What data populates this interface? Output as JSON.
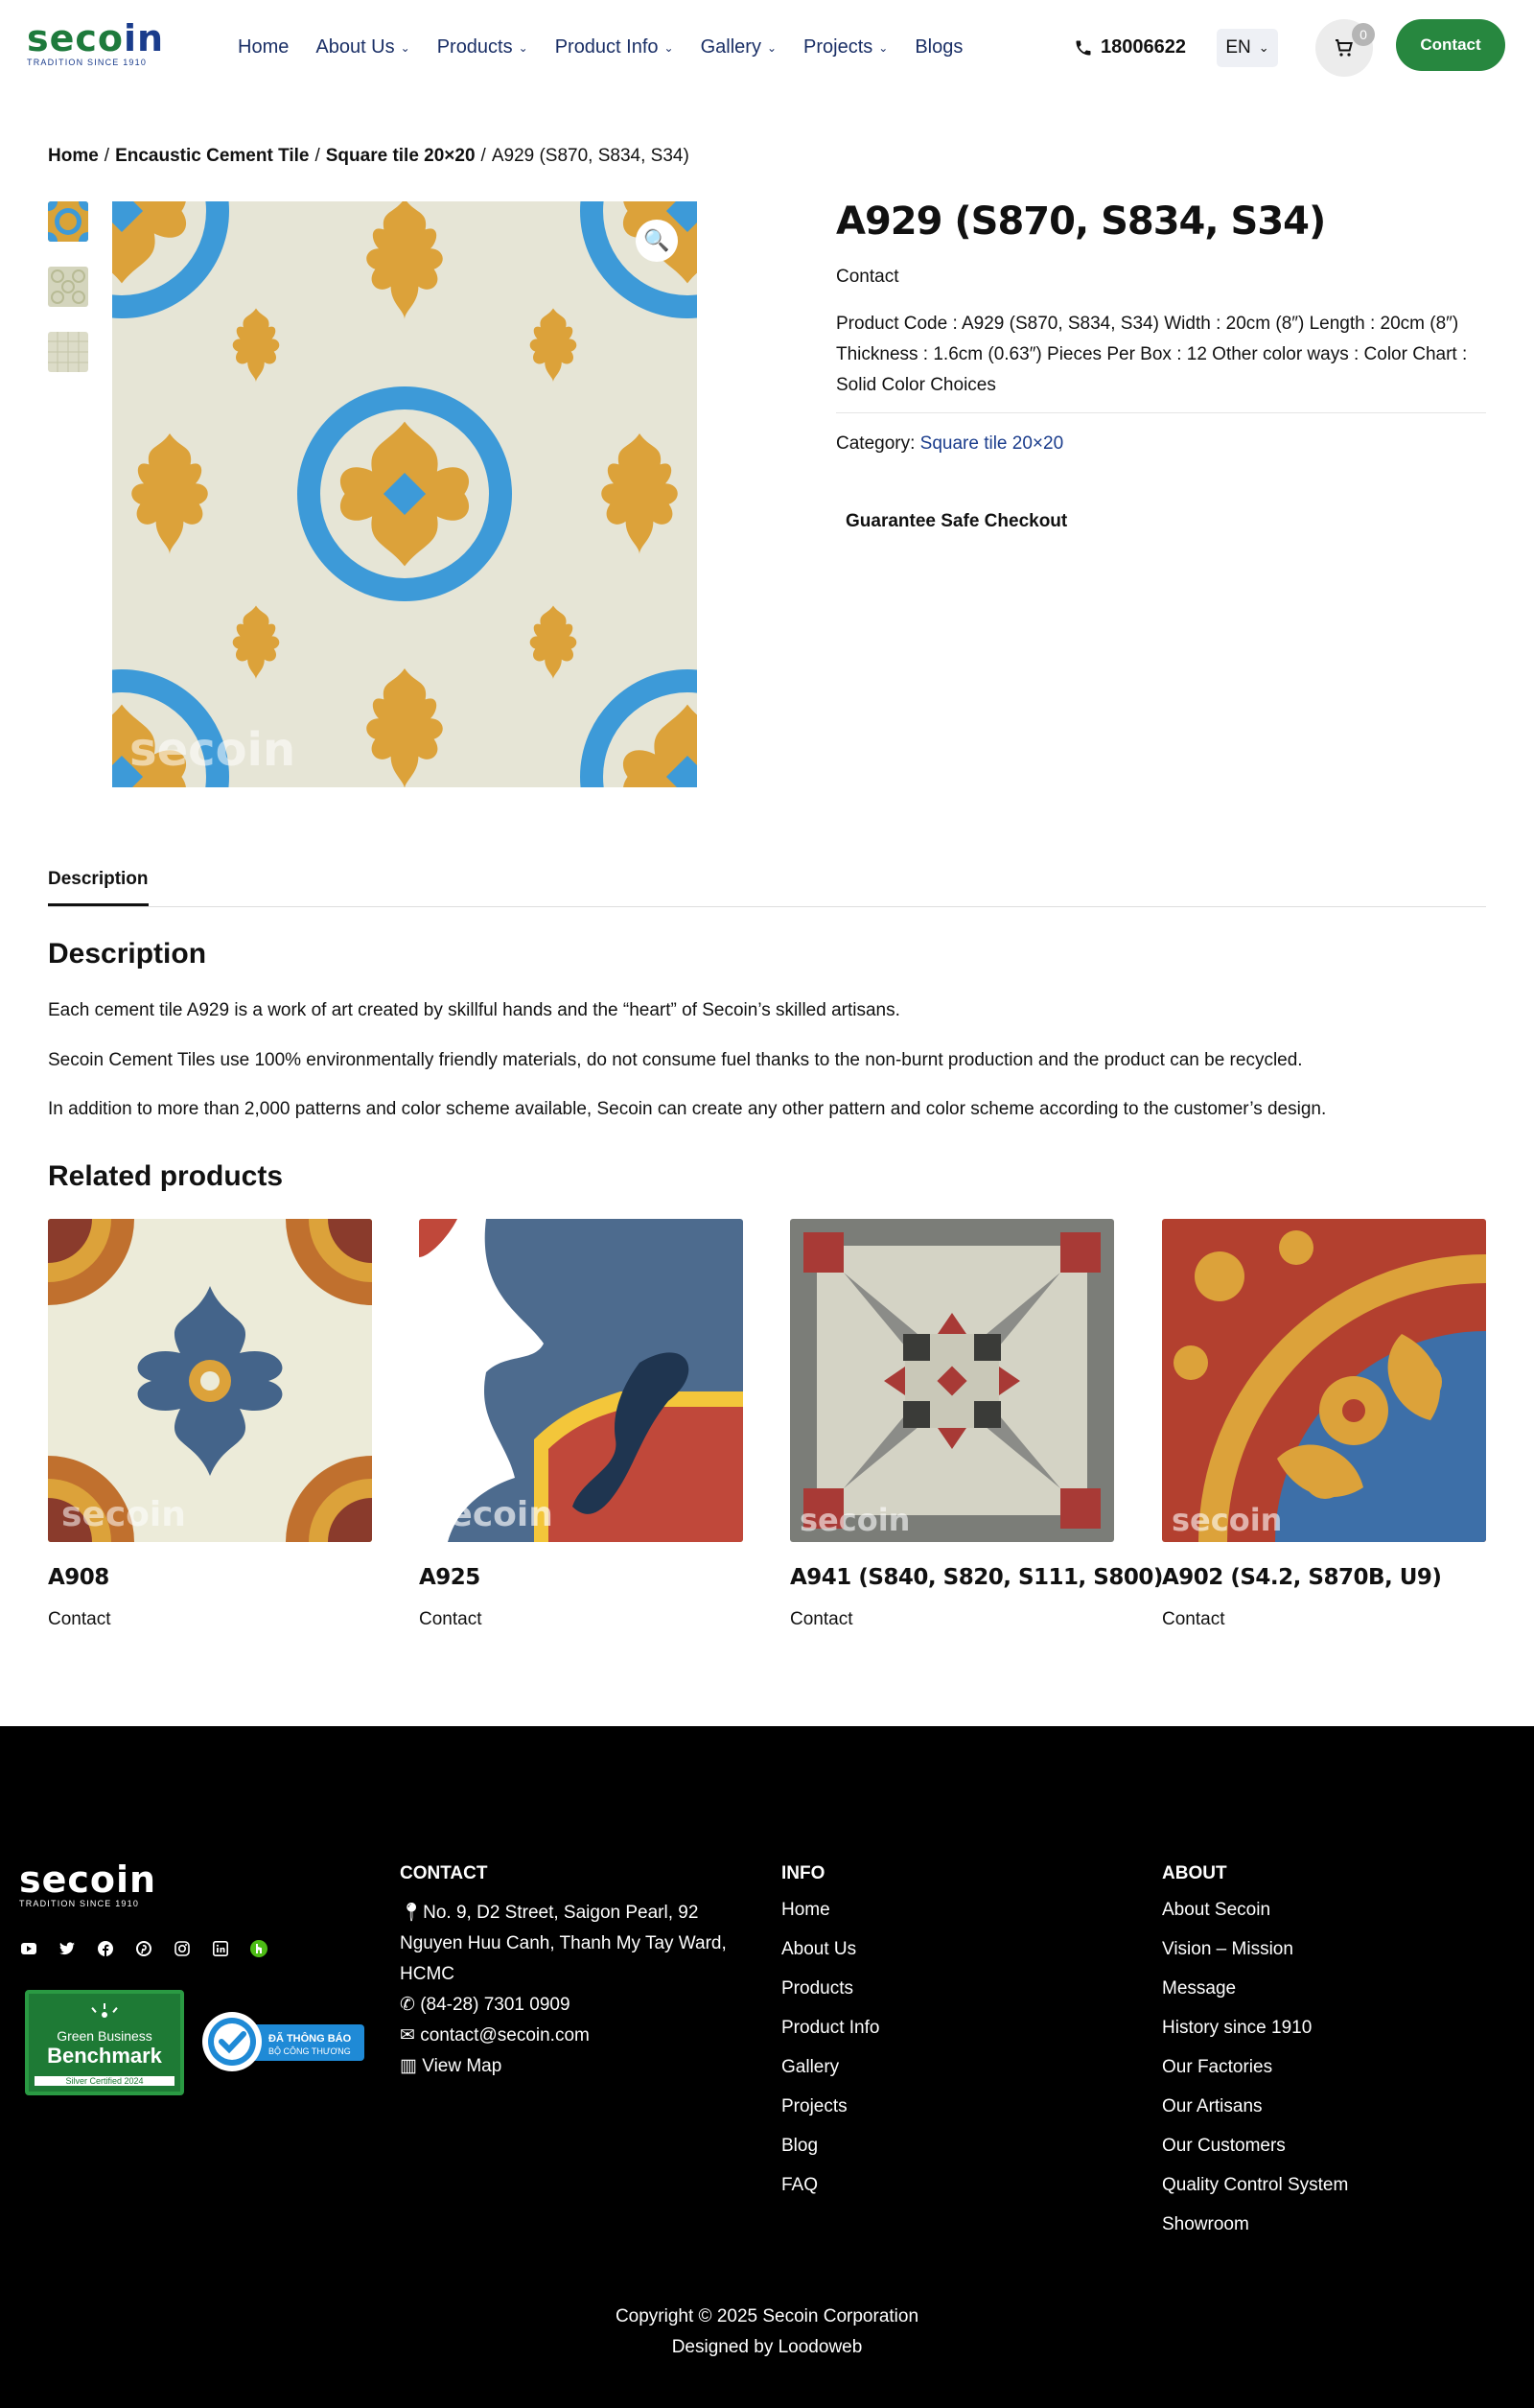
{
  "header": {
    "logo_text_a": "seco",
    "logo_text_b": "in",
    "logo_tagline": "TRADITION SINCE 1910",
    "nav": [
      {
        "label": "Home",
        "has_dropdown": false
      },
      {
        "label": "About Us",
        "has_dropdown": true
      },
      {
        "label": "Products",
        "has_dropdown": true
      },
      {
        "label": "Product Info",
        "has_dropdown": true
      },
      {
        "label": "Gallery",
        "has_dropdown": true
      },
      {
        "label": "Projects",
        "has_dropdown": true
      },
      {
        "label": "Blogs",
        "has_dropdown": false
      }
    ],
    "phone": "18006622",
    "language": "EN",
    "cart_count": "0",
    "contact_label": "Contact"
  },
  "breadcrumb": {
    "items": [
      "Home",
      "Encaustic Cement Tile",
      "Square tile 20×20"
    ],
    "current": "A929 (S870, S834, S34)"
  },
  "product": {
    "title": "A929 (S870, S834, S34)",
    "price": "Contact",
    "description": "Product Code : A929 (S870, S834, S34) Width : 20cm (8″) Length : 20cm (8″) Thickness : 1.6cm (0.63″) Pieces Per Box : 12 Other color ways :   Color Chart : Solid Color Choices",
    "category_label": "Category:",
    "category_value": "Square tile 20×20",
    "guarantee": "Guarantee Safe Checkout",
    "watermark": "secoin"
  },
  "tabs": [
    "Description"
  ],
  "description": {
    "heading": "Description",
    "paragraphs": [
      "Each cement tile A929 is a work of art created by skillful hands and the “heart” of Secoin’s skilled artisans.",
      "Secoin Cement Tiles use 100% environmentally friendly materials, do not consume fuel thanks to the non-burnt production and the product can be recycled.",
      "In addition to more than 2,000 patterns and color scheme available, Secoin can create any other pattern and color scheme according to the customer’s design."
    ]
  },
  "related": {
    "heading": "Related products",
    "items": [
      {
        "name": "A908",
        "price": "Contact"
      },
      {
        "name": "A925",
        "price": "Contact"
      },
      {
        "name": "A941 (S840, S820, S111, S800)",
        "price": "Contact"
      },
      {
        "name": "A902 (S4.2, S870B, U9)",
        "price": "Contact"
      }
    ]
  },
  "footer": {
    "logo_text": "secoin",
    "logo_tagline": "TRADITION SINCE 1910",
    "socials": [
      "youtube-icon",
      "twitter-icon",
      "facebook-icon",
      "pinterest-icon",
      "instagram-icon",
      "linkedin-icon",
      "houzz-icon"
    ],
    "badge_green": {
      "line1": "Green Business",
      "line2": "Benchmark",
      "line3": "Silver Certified 2024"
    },
    "badge_blue": {
      "line1": "ĐÃ THÔNG BÁO",
      "line2": "BỘ CÔNG THƯƠNG"
    },
    "contact": {
      "heading": "CONTACT",
      "address": "No. 9, D2 Street, Saigon Pearl, 92 Nguyen Huu Canh, Thanh My Tay Ward, HCMC",
      "phone": "(84-28) 7301 0909",
      "email": "contact@secoin.com",
      "map": "View Map"
    },
    "info": {
      "heading": "INFO",
      "links": [
        "Home",
        "About Us",
        "Products",
        "Product Info",
        "Gallery",
        "Projects",
        "Blog",
        "FAQ"
      ]
    },
    "about": {
      "heading": "ABOUT",
      "links": [
        "About Secoin",
        "Vision – Mission",
        "Message",
        "History since 1910",
        "Our Factories",
        "Our Artisans",
        "Our Customers",
        "Quality Control System",
        "Showroom"
      ]
    },
    "copyright": "Copyright © 2025 Secoin Corporation",
    "designed_by": "Designed by Loodoweb"
  },
  "colors": {
    "brand_green": "#27873f",
    "brand_navy": "#1a2f66",
    "tile_ochre": "#dca23a",
    "tile_blue": "#3d9ad8",
    "tile_cream": "#e6e5d6"
  }
}
